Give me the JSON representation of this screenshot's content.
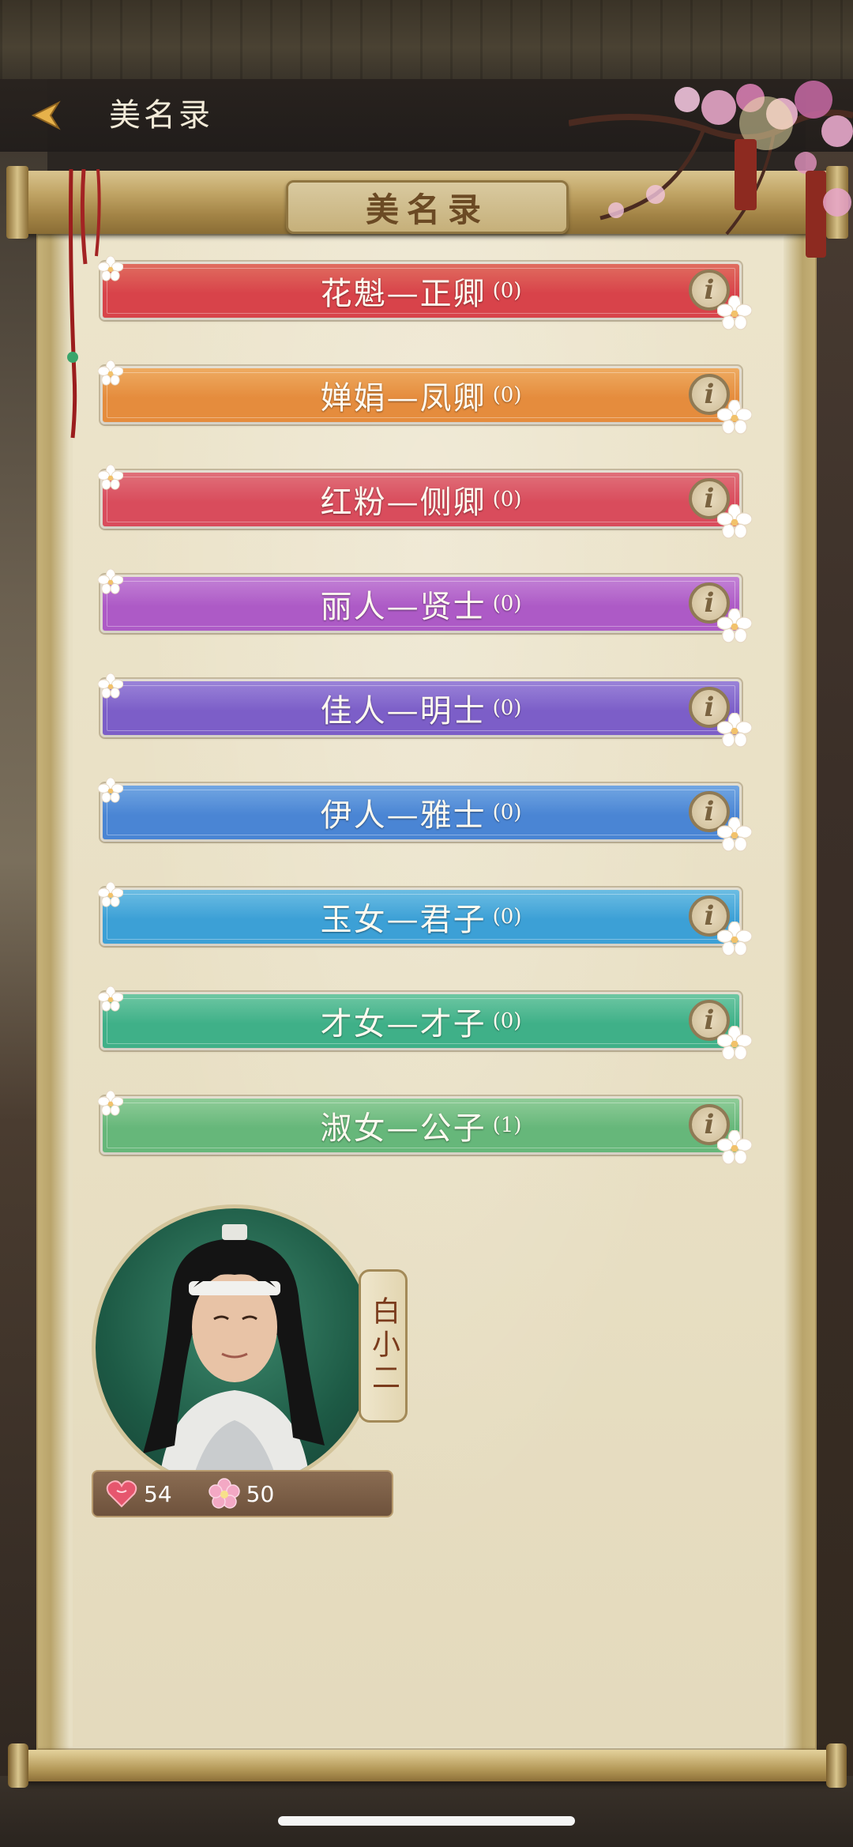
{
  "header": {
    "title": "美名录"
  },
  "scroll": {
    "title": "美名录"
  },
  "ranks": [
    {
      "label": "花魁—正卿",
      "count": "(0)",
      "color": "#d8434a",
      "color2": "#e06d5f"
    },
    {
      "label": "婵娟—凤卿",
      "count": "(0)",
      "color": "#e58c3d",
      "color2": "#eeab61"
    },
    {
      "label": "红粉—侧卿",
      "count": "(0)",
      "color": "#d94c5c",
      "color2": "#e0707a"
    },
    {
      "label": "丽人—贤士",
      "count": "(0)",
      "color": "#ad5ac6",
      "color2": "#c382d6"
    },
    {
      "label": "佳人—明士",
      "count": "(0)",
      "color": "#7c5ec8",
      "color2": "#9a83d8"
    },
    {
      "label": "伊人—雅士",
      "count": "(0)",
      "color": "#4a85d4",
      "color2": "#72a6e2"
    },
    {
      "label": "玉女—君子",
      "count": "(0)",
      "color": "#3ca0d6",
      "color2": "#6cbde3"
    },
    {
      "label": "才女—才子",
      "count": "(0)",
      "color": "#3fb088",
      "color2": "#6ec7a3"
    },
    {
      "label": "淑女—公子",
      "count": "(1)",
      "color": "#66b77a",
      "color2": "#8fcc98"
    }
  ],
  "character": {
    "name": "白小二",
    "affection": "54",
    "charm": "50"
  },
  "icons": {
    "back": "back-arrow-icon",
    "info": "info-icon",
    "heart": "heart-icon",
    "blossom": "blossom-icon"
  },
  "info_glyph": "i"
}
